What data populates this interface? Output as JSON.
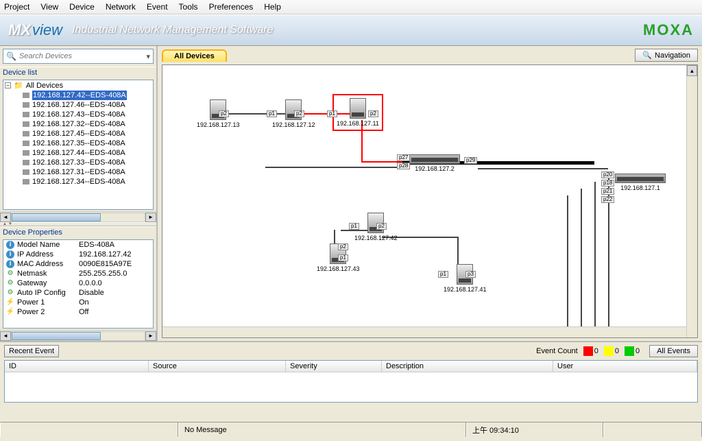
{
  "menu": [
    "Project",
    "View",
    "Device",
    "Network",
    "Event",
    "Tools",
    "Preferences",
    "Help"
  ],
  "banner": {
    "mx": "MX",
    "view": "view",
    "subtitle": "Industrial Network Management Software",
    "brand": "MOXA"
  },
  "search": {
    "placeholder": "Search Devices"
  },
  "sidebar": {
    "title_devicelist": "Device list",
    "root": "All Devices",
    "items": [
      "192.168.127.42--EDS-408A",
      "192.168.127.46--EDS-408A",
      "192.168.127.43--EDS-408A",
      "192.168.127.32--EDS-408A",
      "192.168.127.45--EDS-408A",
      "192.168.127.35--EDS-408A",
      "192.168.127.44--EDS-408A",
      "192.168.127.33--EDS-408A",
      "192.168.127.31--EDS-408A",
      "192.168.127.34--EDS-408A"
    ],
    "title_props": "Device Properties",
    "props": [
      {
        "k": "Model Name",
        "v": "EDS-408A",
        "icon": "info"
      },
      {
        "k": "IP Address",
        "v": "192.168.127.42",
        "icon": "info"
      },
      {
        "k": "MAC Address",
        "v": "0090E815A97E",
        "icon": "info"
      },
      {
        "k": "Netmask",
        "v": "255.255.255.0",
        "icon": "gear"
      },
      {
        "k": "Gateway",
        "v": "0.0.0.0",
        "icon": "gear"
      },
      {
        "k": "Auto IP Config",
        "v": "Disable",
        "icon": "gear"
      },
      {
        "k": "Power 1",
        "v": "On",
        "icon": "pwr"
      },
      {
        "k": "Power 2",
        "v": "Off",
        "icon": "pwr"
      }
    ]
  },
  "topology": {
    "tab": "All Devices",
    "nav": "Navigation",
    "nodes": {
      "n13": "192.168.127.13",
      "n12": "192.168.127.12",
      "n11": "192.168.127.11",
      "n2": "192.168.127.2",
      "n1": "192.168.127.1",
      "n43": "192.168.127.43",
      "n42": "192.168.127.42",
      "n41": "192.168.127.41"
    },
    "ports": {
      "p1": "p1",
      "p2": "p2",
      "p3": "p3",
      "p18": "p18",
      "p20": "p20",
      "p21": "p21",
      "p22": "p22",
      "p27": "p27",
      "p28": "p28",
      "p29": "p29"
    }
  },
  "events": {
    "recent": "Recent Event",
    "countlabel": "Event Count",
    "c_red": "0",
    "c_yel": "0",
    "c_grn": "0",
    "all": "All Events",
    "cols": {
      "id": "ID",
      "source": "Source",
      "severity": "Severity",
      "description": "Description",
      "user": "User"
    }
  },
  "status": {
    "msg": "No Message",
    "time": "上午 09:34:10"
  }
}
